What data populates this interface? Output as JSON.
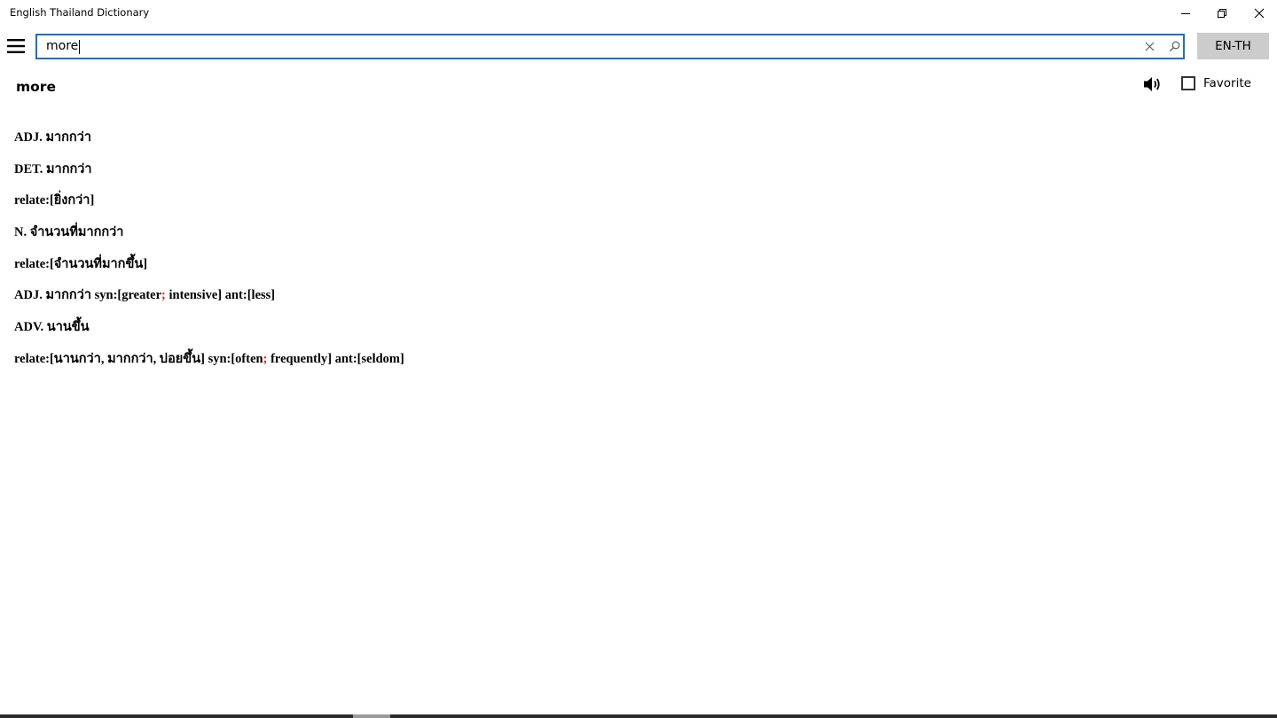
{
  "window": {
    "title": "English Thailand Dictionary"
  },
  "icons": {
    "minimize": "minimize-icon",
    "restore": "restore-icon",
    "close": "close-icon",
    "menu": "hamburger-menu-icon",
    "clear": "clear-x-icon",
    "search": "search-icon",
    "speaker": "speaker-icon",
    "favorite": "checkbox-icon"
  },
  "colors": {
    "search_border": "#1f6dc4",
    "lang_button_bg": "#cccccc",
    "separator": "#e02020"
  },
  "search": {
    "value": "more",
    "placeholder": ""
  },
  "language_button": {
    "label": "EN-TH"
  },
  "entry": {
    "headword": "more",
    "favorite_label": "Favorite",
    "favorite_checked": false,
    "definitions": [
      {
        "segments": [
          {
            "text": "ADJ. มากกว่า"
          }
        ]
      },
      {
        "segments": [
          {
            "text": "DET. มากกว่า"
          }
        ]
      },
      {
        "segments": [
          {
            "text": "relate:[ยิ่งกว่า]"
          }
        ]
      },
      {
        "segments": [
          {
            "text": "N. จำนวนที่มากกว่า"
          }
        ]
      },
      {
        "segments": [
          {
            "text": "relate:[จำนวนที่มากขึ้น]"
          }
        ]
      },
      {
        "segments": [
          {
            "text": "ADJ. มากกว่า syn:[greater"
          },
          {
            "text": ";",
            "sep": true
          },
          {
            "text": " intensive] ant:[less]"
          }
        ]
      },
      {
        "segments": [
          {
            "text": "ADV. นานขึ้น"
          }
        ]
      },
      {
        "segments": [
          {
            "text": "relate:[นานกว่า, มากกว่า, บ่อยขึ้น] syn:[often"
          },
          {
            "text": ";",
            "sep": true
          },
          {
            "text": " frequently] ant:[seldom]"
          }
        ]
      }
    ]
  }
}
